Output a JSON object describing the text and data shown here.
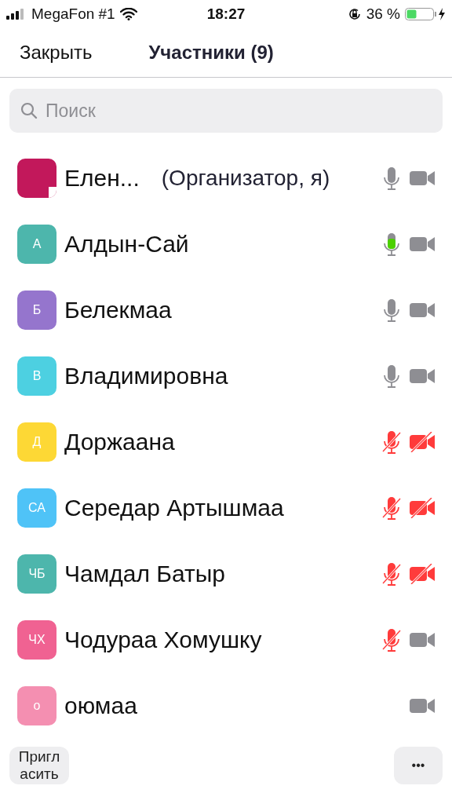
{
  "status_bar": {
    "carrier": "MegaFon #1",
    "time": "18:27",
    "battery": "36 %"
  },
  "nav": {
    "close": "Закрыть",
    "title": "Участники (9)"
  },
  "search": {
    "placeholder": "Поиск"
  },
  "participants": [
    {
      "name": "Елен...",
      "role": "(Организатор, я)",
      "color": "#c2185b",
      "has_audio": true,
      "muted": false,
      "speaking": false,
      "video_on": true
    },
    {
      "initials": "А",
      "name": "Алдын-Сай",
      "color": "#4db6ac",
      "has_audio": true,
      "muted": false,
      "speaking": true,
      "video_on": true
    },
    {
      "initials": "Б",
      "name": "Белекмаа",
      "color": "#9575cd",
      "has_audio": true,
      "muted": false,
      "speaking": false,
      "video_on": true
    },
    {
      "initials": "В",
      "name": "Владимировна",
      "color": "#4dd0e1",
      "has_audio": true,
      "muted": false,
      "speaking": false,
      "video_on": true
    },
    {
      "initials": "Д",
      "name": "Доржаана",
      "color": "#fdd835",
      "has_audio": true,
      "muted": true,
      "speaking": false,
      "video_on": false
    },
    {
      "initials": "СА",
      "name": "Середар Артышмаа",
      "color": "#4fc3f7",
      "has_audio": true,
      "muted": true,
      "speaking": false,
      "video_on": false
    },
    {
      "initials": "ЧБ",
      "name": "Чамдал Батыр",
      "color": "#4db6ac",
      "has_audio": true,
      "muted": true,
      "speaking": false,
      "video_on": false
    },
    {
      "initials": "ЧХ",
      "name": "Чодураа Хомушку",
      "color": "#f06292",
      "has_audio": true,
      "muted": true,
      "speaking": false,
      "video_on": true
    },
    {
      "initials": "о",
      "name": "оюмаа",
      "color": "#f48fb1",
      "has_audio": false,
      "video_on": true
    }
  ],
  "footer": {
    "invite": "Пригл асить",
    "more": "•••"
  }
}
